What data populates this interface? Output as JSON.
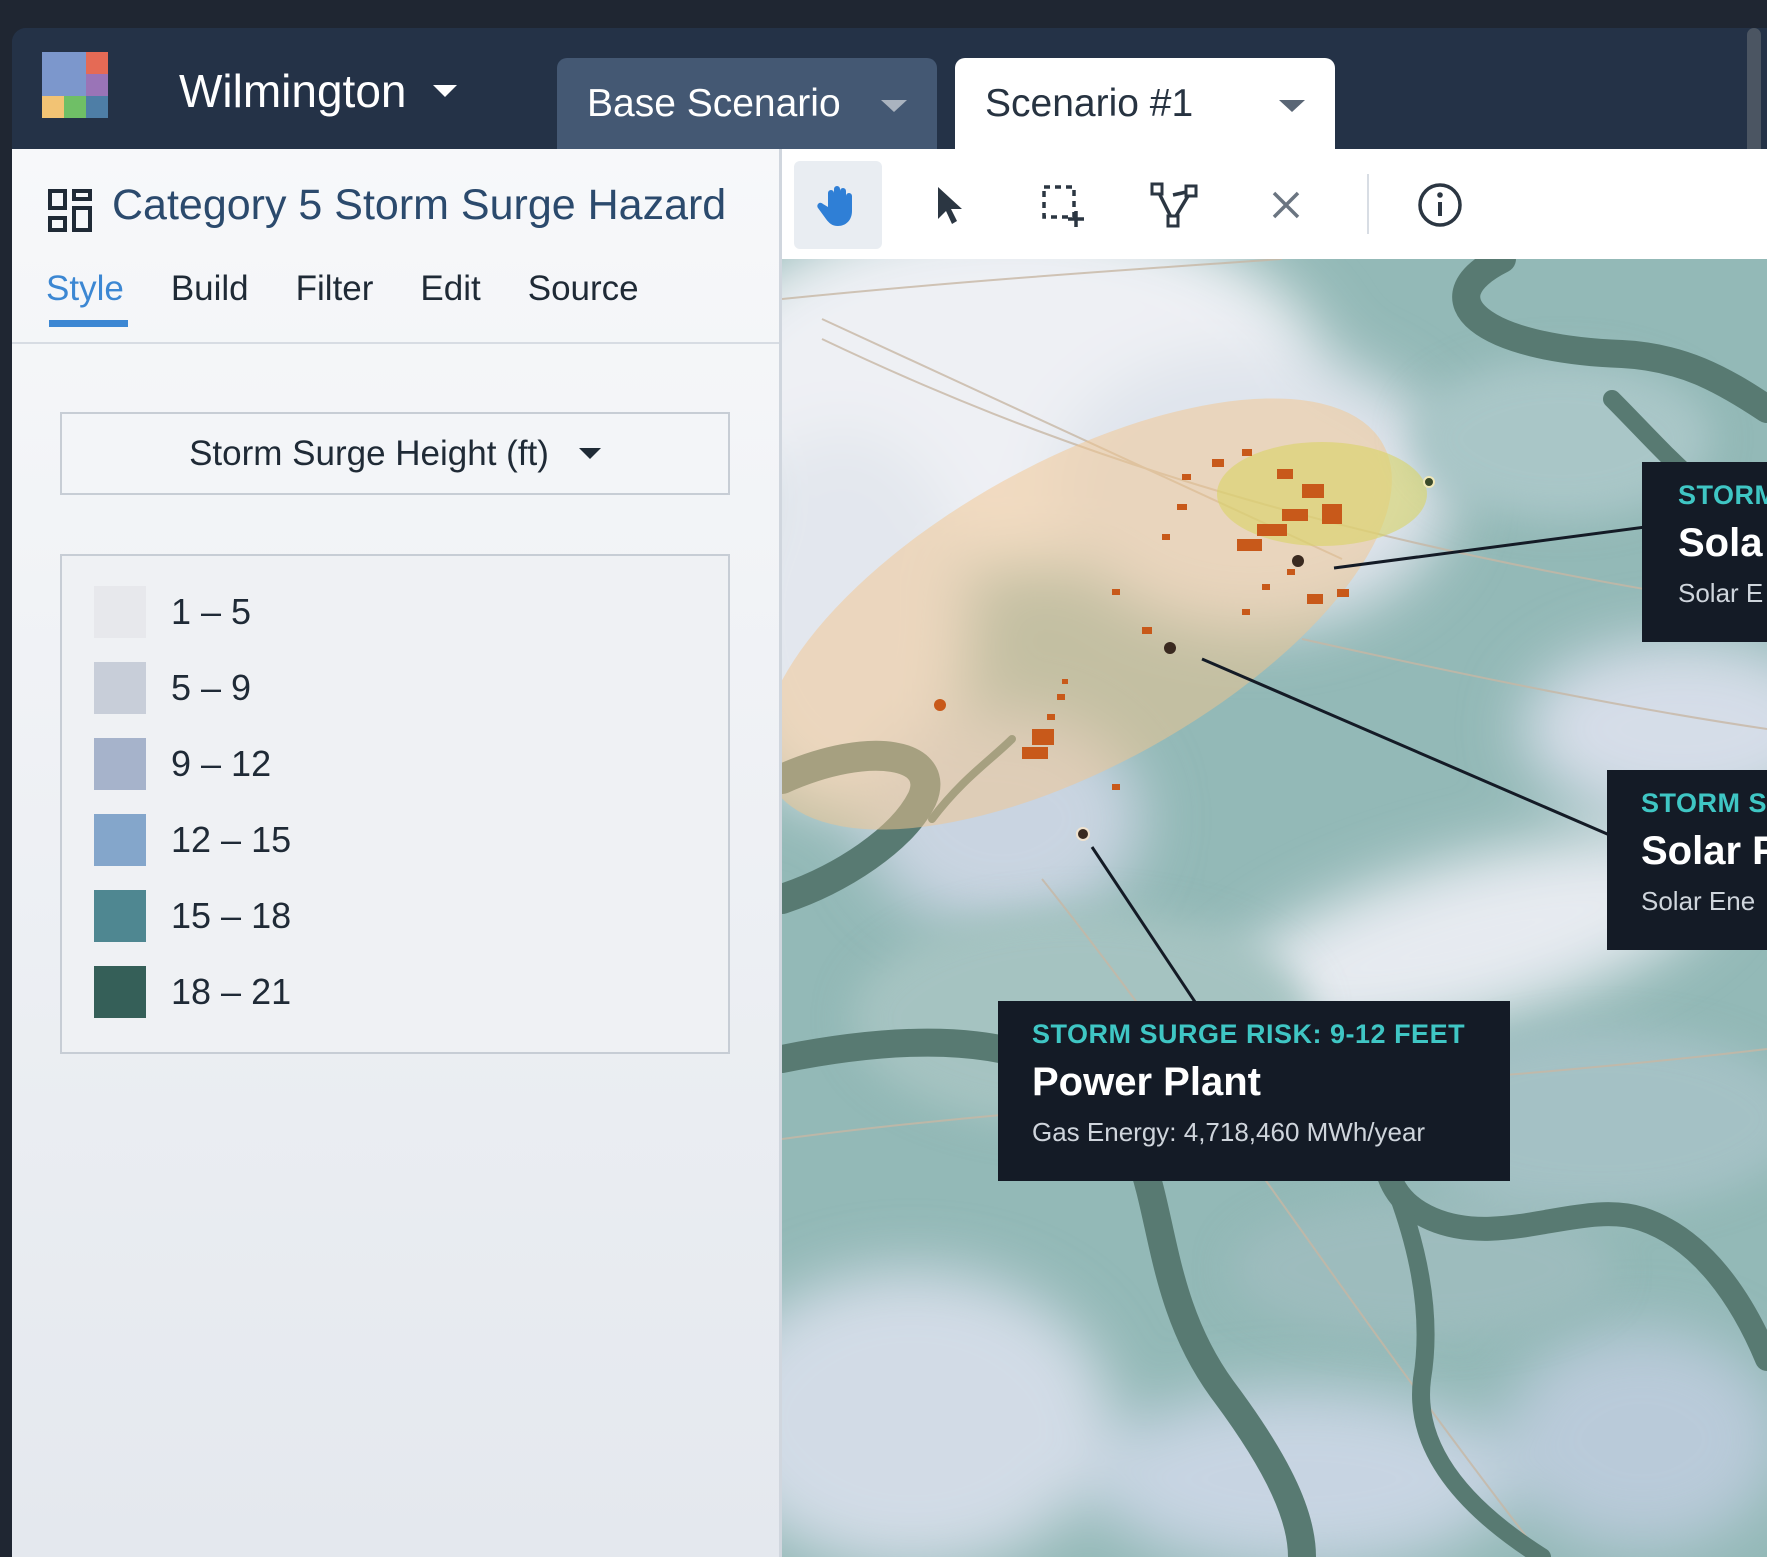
{
  "header": {
    "city": "Wilmington",
    "tabs": [
      {
        "label": "Base Scenario",
        "active": false
      },
      {
        "label": "Scenario #1",
        "active": true
      }
    ]
  },
  "layer_panel": {
    "title": "Category 5 Storm Surge Hazard",
    "subtabs": [
      "Style",
      "Build",
      "Filter",
      "Edit",
      "Source"
    ],
    "active_subtab": "Style",
    "field_select": "Storm Surge Height (ft)",
    "legend": [
      {
        "label": "1 – 5",
        "color": "#e7e8ec"
      },
      {
        "label": "5 – 9",
        "color": "#c8ced9"
      },
      {
        "label": "9 – 12",
        "color": "#a6b3cb"
      },
      {
        "label": "12 – 15",
        "color": "#84a6cb"
      },
      {
        "label": "15 – 18",
        "color": "#4f8791"
      },
      {
        "label": "18 – 21",
        "color": "#355f58"
      }
    ]
  },
  "toolbar": {
    "tools": [
      "hand-pan",
      "pointer-select",
      "box-select",
      "vertex-edit",
      "clear",
      "info"
    ],
    "active_tool": "hand-pan"
  },
  "map": {
    "callouts": [
      {
        "risk": "STORM SURGE RISK: 9-12 FEET",
        "name": "Power Plant",
        "meta": "Gas Energy:  4,718,460 MWh/year"
      },
      {
        "risk": "STORM",
        "name": "Sola",
        "meta": "Solar E"
      },
      {
        "risk": "STORM S",
        "name": "Solar F",
        "meta": "Solar Ene"
      }
    ]
  },
  "colors": {
    "accent": "#3c87d3",
    "header_bg": "#243247",
    "callout_bg": "#141b26",
    "callout_risk": "#3fc6c4",
    "asset_orange": "#c8591a"
  }
}
